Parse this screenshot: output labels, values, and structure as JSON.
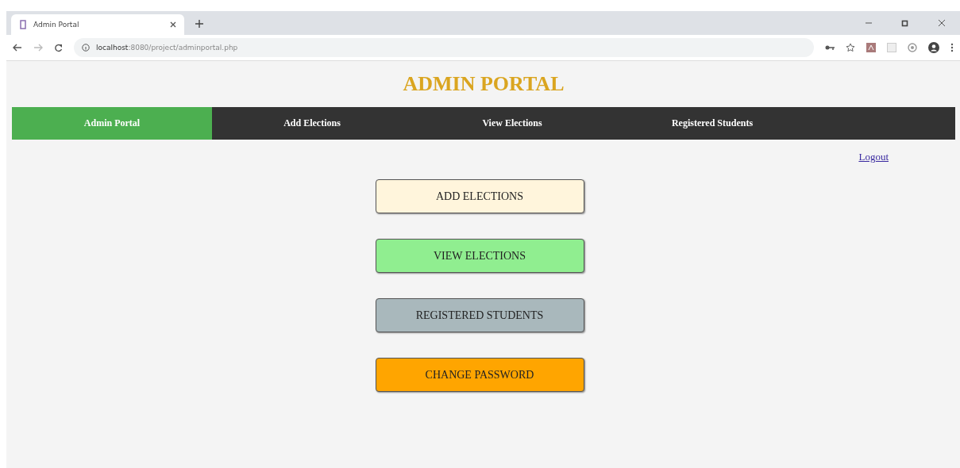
{
  "browser": {
    "tab_title": "Admin Portal",
    "url_host": "localhost",
    "url_path": ":8080/project/adminportal.php"
  },
  "page": {
    "title": "ADMIN PORTAL",
    "nav": [
      {
        "label": "Admin Portal",
        "selected": true
      },
      {
        "label": "Add Elections",
        "selected": false
      },
      {
        "label": "View Elections",
        "selected": false
      },
      {
        "label": "Registered Students",
        "selected": false
      }
    ],
    "logout": "Logout",
    "buttons": [
      {
        "label": "ADD ELECTIONS",
        "color": "#fff5dc"
      },
      {
        "label": "VIEW ELECTIONS",
        "color": "#90ee90"
      },
      {
        "label": "REGISTERED STUDENTS",
        "color": "#a9b8bc"
      },
      {
        "label": "CHANGE PASSWORD",
        "color": "#ffa500"
      }
    ]
  }
}
